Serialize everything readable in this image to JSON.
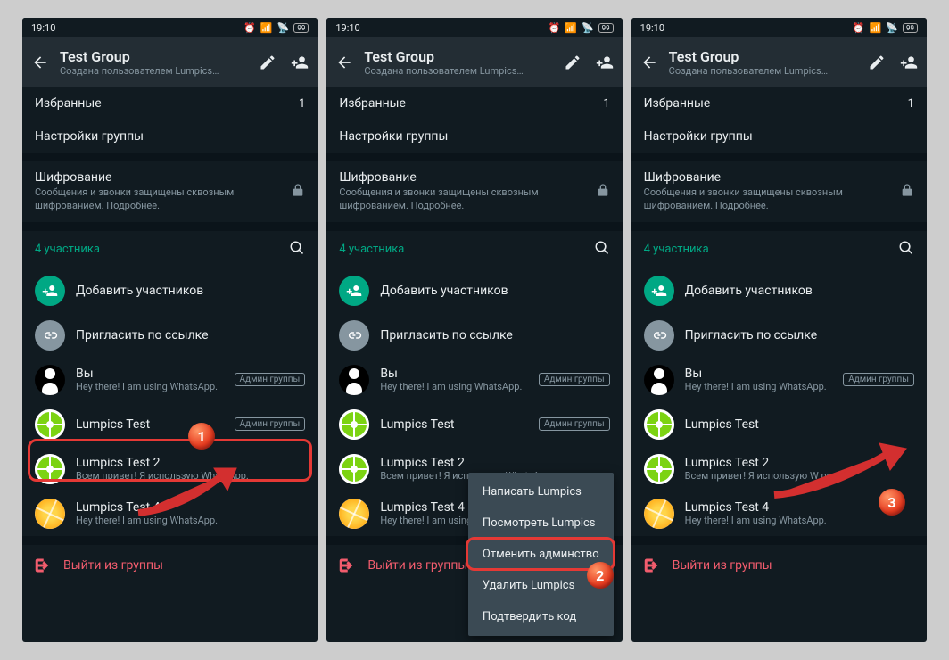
{
  "status": {
    "time": "19:10",
    "battery": "99"
  },
  "header": {
    "title": "Test Group",
    "subtitle": "Создана пользователем Lumpics…"
  },
  "rows": {
    "favorites": "Избранные",
    "favorites_count": "1",
    "group_settings": "Настройки группы"
  },
  "encryption": {
    "title": "Шифрование",
    "body": "Сообщения и звонки защищены сквозным шифрованием. Подробнее."
  },
  "participants": {
    "count_label": "4 участника",
    "add": "Добавить участников",
    "invite": "Пригласить по ссылке",
    "you": "Вы",
    "you_status": "Hey there! I am using WhatsApp.",
    "p1": "Lumpics Test",
    "p2": "Lumpics Test 2",
    "p2_status": "Всем привет! Я использую WhatsApp.",
    "p2_status_cut": "Всем привет! Я использую W         pp.",
    "p3": "Lumpics Test 4",
    "p3_status": "Hey there! I am using WhatsApp.",
    "admin_badge": "Админ группы"
  },
  "leave": "Выйти из группы",
  "context_menu": {
    "write": "Написать Lumpics",
    "view": "Посмотреть Lumpics",
    "dismiss": "Отменить админство",
    "remove": "Удалить Lumpics",
    "verify": "Подтвердить код"
  },
  "markers": {
    "m1": "1",
    "m2": "2",
    "m3": "3"
  }
}
